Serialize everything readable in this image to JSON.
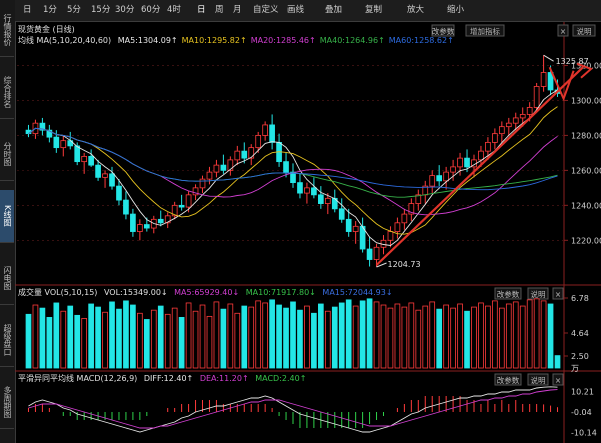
{
  "sidebar": {
    "tabs": [
      {
        "label": "行情报价",
        "active": false
      },
      {
        "label": "综合排名",
        "active": false
      },
      {
        "label": "分时图",
        "active": false
      },
      {
        "label": "K线图",
        "active": true
      },
      {
        "label": "闪电图",
        "active": false
      },
      {
        "label": "超级盘口",
        "active": false
      },
      {
        "label": "多周期图",
        "active": false
      }
    ]
  },
  "toolbar": {
    "items": [
      "日",
      "1分",
      "5分",
      "15分",
      "30分",
      "60分",
      "4时",
      "日",
      "周",
      "月",
      "自定义",
      "画线",
      "叠加",
      "复制",
      "放大",
      "缩小"
    ],
    "selected_index": 7
  },
  "instrument": {
    "name": "现货黄金 (日线)"
  },
  "main_panel": {
    "ma_label": "均线 MA(5,10,20,40,60)",
    "ma_values": [
      {
        "text": "MA5:1304.09↑",
        "color": "#e8e8e8"
      },
      {
        "text": "MA10:1295.82↑",
        "color": "#e7c320"
      },
      {
        "text": "MA20:1285.46↑",
        "color": "#d23fd2"
      },
      {
        "text": "MA40:1264.96↑",
        "color": "#37b24a"
      },
      {
        "text": "MA60:1258.62↑",
        "color": "#2d6be0"
      }
    ],
    "buttons": [
      "改参数",
      "增加指标",
      "×",
      "说明"
    ],
    "high_label": "1325.87",
    "low_label": "1204.73"
  },
  "volume_panel": {
    "label": "成交量 VOL(5,10,15)",
    "vol": "VOL:15349.00↓",
    "ma5": "MA5:65929.40↓",
    "ma10": "MA10:71917.80↓",
    "ma15": "MA15:72044.93↓",
    "buttons": [
      "改参数",
      "说明",
      "×"
    ],
    "axis_labels": [
      "6.78",
      "4.64",
      "2.50",
      "万"
    ]
  },
  "macd_panel": {
    "label": "平滑异同平均线 MACD(12,26,9)",
    "diff": "DIFF:12.40↑",
    "dea": "DEA:11.20↑",
    "macd": "MACD:2.40↑",
    "buttons": [
      "改参数",
      "说明",
      "×"
    ],
    "axis_labels": [
      "10.21",
      "-0.04",
      "-10.14"
    ]
  },
  "chart_data": {
    "type": "candlestick",
    "ylim": [
      1195,
      1330
    ],
    "y_ticks": [
      1220,
      1240,
      1260,
      1280,
      1300,
      1320
    ],
    "candles": [
      [
        1283,
        1286,
        1279,
        1281
      ],
      [
        1281,
        1289,
        1278,
        1287
      ],
      [
        1287,
        1290,
        1280,
        1283
      ],
      [
        1283,
        1286,
        1276,
        1279
      ],
      [
        1279,
        1283,
        1270,
        1273
      ],
      [
        1273,
        1280,
        1268,
        1277
      ],
      [
        1277,
        1282,
        1272,
        1274
      ],
      [
        1274,
        1276,
        1263,
        1265
      ],
      [
        1265,
        1270,
        1258,
        1268
      ],
      [
        1268,
        1272,
        1262,
        1263
      ],
      [
        1263,
        1266,
        1254,
        1256
      ],
      [
        1256,
        1260,
        1250,
        1258
      ],
      [
        1258,
        1262,
        1249,
        1251
      ],
      [
        1251,
        1255,
        1240,
        1243
      ],
      [
        1243,
        1248,
        1232,
        1235
      ],
      [
        1235,
        1238,
        1222,
        1225
      ],
      [
        1225,
        1232,
        1220,
        1229
      ],
      [
        1229,
        1233,
        1225,
        1227
      ],
      [
        1227,
        1234,
        1224,
        1232
      ],
      [
        1232,
        1237,
        1228,
        1230
      ],
      [
        1230,
        1236,
        1227,
        1234
      ],
      [
        1234,
        1242,
        1232,
        1240
      ],
      [
        1240,
        1246,
        1237,
        1239
      ],
      [
        1239,
        1248,
        1236,
        1246
      ],
      [
        1246,
        1252,
        1243,
        1250
      ],
      [
        1250,
        1257,
        1247,
        1255
      ],
      [
        1255,
        1262,
        1252,
        1259
      ],
      [
        1259,
        1266,
        1256,
        1263
      ],
      [
        1263,
        1269,
        1258,
        1260
      ],
      [
        1260,
        1268,
        1257,
        1266
      ],
      [
        1266,
        1274,
        1263,
        1271
      ],
      [
        1271,
        1276,
        1264,
        1267
      ],
      [
        1267,
        1275,
        1263,
        1273
      ],
      [
        1273,
        1282,
        1270,
        1280
      ],
      [
        1280,
        1288,
        1277,
        1286
      ],
      [
        1286,
        1292,
        1272,
        1276
      ],
      [
        1276,
        1281,
        1262,
        1265
      ],
      [
        1265,
        1270,
        1256,
        1259
      ],
      [
        1259,
        1264,
        1250,
        1253
      ],
      [
        1253,
        1258,
        1244,
        1247
      ],
      [
        1247,
        1253,
        1241,
        1250
      ],
      [
        1250,
        1256,
        1244,
        1246
      ],
      [
        1246,
        1251,
        1238,
        1241
      ],
      [
        1241,
        1247,
        1235,
        1244
      ],
      [
        1244,
        1249,
        1236,
        1238
      ],
      [
        1238,
        1244,
        1230,
        1232
      ],
      [
        1232,
        1238,
        1222,
        1225
      ],
      [
        1225,
        1231,
        1218,
        1228
      ],
      [
        1228,
        1233,
        1213,
        1215
      ],
      [
        1215,
        1222,
        1205,
        1209
      ],
      [
        1209,
        1218,
        1204.73,
        1216
      ],
      [
        1216,
        1223,
        1212,
        1220
      ],
      [
        1220,
        1228,
        1216,
        1225
      ],
      [
        1225,
        1233,
        1221,
        1230
      ],
      [
        1230,
        1238,
        1226,
        1235
      ],
      [
        1235,
        1244,
        1231,
        1241
      ],
      [
        1241,
        1249,
        1237,
        1246
      ],
      [
        1246,
        1254,
        1241,
        1251
      ],
      [
        1251,
        1260,
        1247,
        1257
      ],
      [
        1257,
        1263,
        1251,
        1254
      ],
      [
        1254,
        1262,
        1249,
        1259
      ],
      [
        1259,
        1266,
        1254,
        1262
      ],
      [
        1262,
        1270,
        1257,
        1267
      ],
      [
        1267,
        1272,
        1259,
        1262
      ],
      [
        1262,
        1269,
        1256,
        1266
      ],
      [
        1266,
        1274,
        1262,
        1271
      ],
      [
        1271,
        1279,
        1266,
        1276
      ],
      [
        1276,
        1284,
        1272,
        1281
      ],
      [
        1281,
        1288,
        1276,
        1285
      ],
      [
        1285,
        1290,
        1280,
        1287
      ],
      [
        1287,
        1293,
        1283,
        1290
      ],
      [
        1290,
        1296,
        1285,
        1292
      ],
      [
        1292,
        1299,
        1288,
        1296
      ],
      [
        1296,
        1310,
        1294,
        1308
      ],
      [
        1308,
        1325.87,
        1305,
        1316
      ],
      [
        1316,
        1320,
        1303,
        1306
      ],
      [
        1306,
        1312,
        1302,
        1304
      ]
    ],
    "volumes": [
      5.2,
      6.1,
      5.8,
      4.9,
      6.3,
      5.5,
      6.0,
      5.1,
      4.8,
      6.2,
      5.9,
      5.4,
      6.4,
      5.7,
      6.5,
      6.1,
      5.3,
      4.7,
      5.6,
      6.0,
      5.2,
      5.8,
      4.9,
      6.3,
      5.5,
      6.1,
      5.0,
      6.4,
      5.7,
      6.2,
      5.3,
      6.0,
      5.9,
      6.5,
      6.3,
      6.6,
      6.1,
      5.8,
      6.4,
      5.6,
      6.0,
      5.3,
      6.2,
      5.5,
      5.9,
      6.3,
      6.6,
      6.0,
      6.5,
      6.7,
      6.4,
      6.1,
      5.8,
      6.2,
      5.9,
      6.3,
      5.6,
      6.0,
      6.4,
      5.7,
      6.1,
      5.8,
      6.2,
      5.5,
      5.9,
      6.3,
      6.0,
      6.5,
      5.8,
      6.2,
      6.4,
      6.0,
      6.6,
      6.7,
      6.5,
      6.2,
      1.2
    ],
    "macd_diff": [
      3,
      5,
      6,
      5,
      4,
      2,
      1,
      -1,
      -2,
      -3,
      -4,
      -5,
      -6,
      -7,
      -8,
      -9,
      -10,
      -9,
      -8,
      -7,
      -6,
      -5,
      -3,
      -2,
      0,
      1,
      2,
      3,
      3,
      4,
      5,
      6,
      7,
      7,
      8,
      7,
      5,
      3,
      1,
      -1,
      -2,
      -3,
      -4,
      -5,
      -6,
      -7,
      -8,
      -9,
      -10,
      -10,
      -9,
      -8,
      -7,
      -5,
      -3,
      -1,
      0,
      2,
      3,
      4,
      5,
      6,
      7,
      7,
      8,
      8,
      9,
      9,
      10,
      10,
      11,
      11,
      11,
      12,
      12.4,
      12.6,
      12.4
    ],
    "macd_dea": [
      2,
      3,
      4,
      4,
      4,
      3,
      2,
      1,
      0,
      -1,
      -2,
      -3,
      -4,
      -5,
      -6,
      -7,
      -8,
      -8,
      -8,
      -7,
      -7,
      -6,
      -5,
      -4,
      -3,
      -2,
      -1,
      0,
      1,
      2,
      3,
      4,
      5,
      5,
      6,
      6,
      6,
      5,
      4,
      3,
      2,
      1,
      0,
      -1,
      -2,
      -3,
      -4,
      -5,
      -6,
      -7,
      -7,
      -7,
      -7,
      -6,
      -5,
      -4,
      -3,
      -2,
      -1,
      0,
      1,
      2,
      3,
      4,
      5,
      6,
      6,
      7,
      7,
      8,
      8,
      9,
      9,
      10,
      10.5,
      11,
      11.2
    ]
  }
}
